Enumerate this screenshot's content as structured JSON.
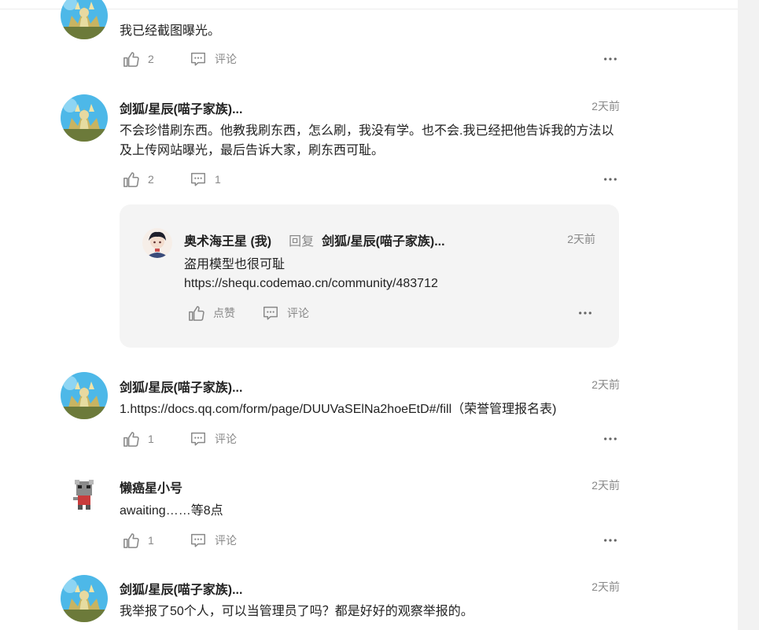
{
  "colors": {
    "text": "#222222",
    "muted": "#888888",
    "reply_bg": "#f4f4f4",
    "scrollbar": "#f2f2f2"
  },
  "labels": {
    "comment": "评论",
    "like": "点赞",
    "reply": "回复"
  },
  "comments": [
    {
      "author": "",
      "time": "",
      "text": "我已经截图曝光。",
      "likes": "2",
      "comment_label": "评论"
    },
    {
      "author": "剑狐/星辰(喵子家族)...",
      "time": "2天前",
      "text": "不会珍惜刷东西。他教我刷东西，怎么刷，我没有学。也不会.我已经把他告诉我的方法以及上传网站曝光，最后告诉大家，刷东西可耻。",
      "likes": "2",
      "comment_label": "1"
    },
    {
      "author": "剑狐/星辰(喵子家族)...",
      "time": "2天前",
      "text": "1.https://docs.qq.com/form/page/DUUVaSElNa2hoeEtD#/fill（荣誉管理报名表)",
      "likes": "1",
      "comment_label": "评论"
    },
    {
      "author": "懒癌星小号",
      "time": "2天前",
      "text": "awaiting……等8点",
      "likes": "1",
      "comment_label": "评论"
    },
    {
      "author": "剑狐/星辰(喵子家族)...",
      "time": "2天前",
      "text": "我举报了50个人，可以当管理员了吗？都是好好的观察举报的。"
    }
  ],
  "reply": {
    "author": "奥术海王星 (我)",
    "verb": "回复",
    "target": "剑狐/星辰(喵子家族)...",
    "time": "2天前",
    "line1": "盗用模型也很可耻",
    "line2": "https://shequ.codemao.cn/community/483712",
    "like_label": "点赞",
    "comment_label": "评论"
  }
}
